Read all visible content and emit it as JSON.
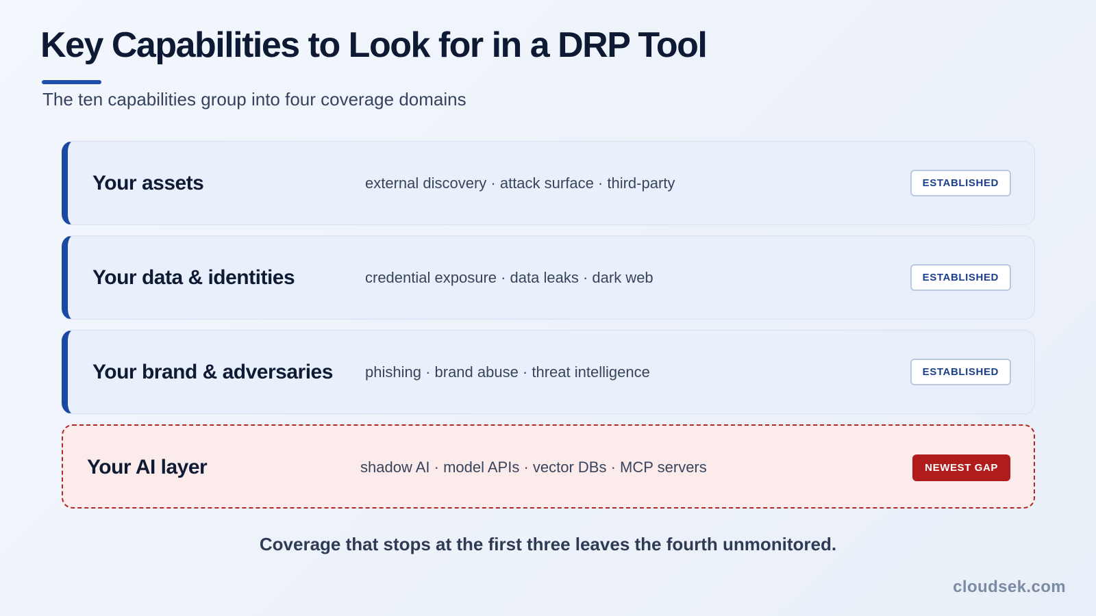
{
  "header": {
    "title": "Key Capabilities to Look for in a DRP Tool",
    "subtitle": "The ten capabilities group into four coverage domains"
  },
  "domains": [
    {
      "title": "Your assets",
      "items": "external discovery · attack surface · third-party",
      "badge": "ESTABLISHED"
    },
    {
      "title": "Your data & identities",
      "items": "credential exposure · data leaks · dark web",
      "badge": "ESTABLISHED"
    },
    {
      "title": "Your brand & adversaries",
      "items": "phishing · brand abuse · threat intelligence",
      "badge": "ESTABLISHED"
    },
    {
      "title": "Your AI layer",
      "items": "shadow AI · model APIs · vector DBs · MCP servers",
      "badge": "NEWEST GAP"
    }
  ],
  "footer": {
    "note": "Coverage that stops at the first three leaves the fourth unmonitored.",
    "brand": "cloudsek.com"
  },
  "colors": {
    "accent": "#1a48a3",
    "gap": "#b01c1c",
    "title": "#0e1a33"
  }
}
